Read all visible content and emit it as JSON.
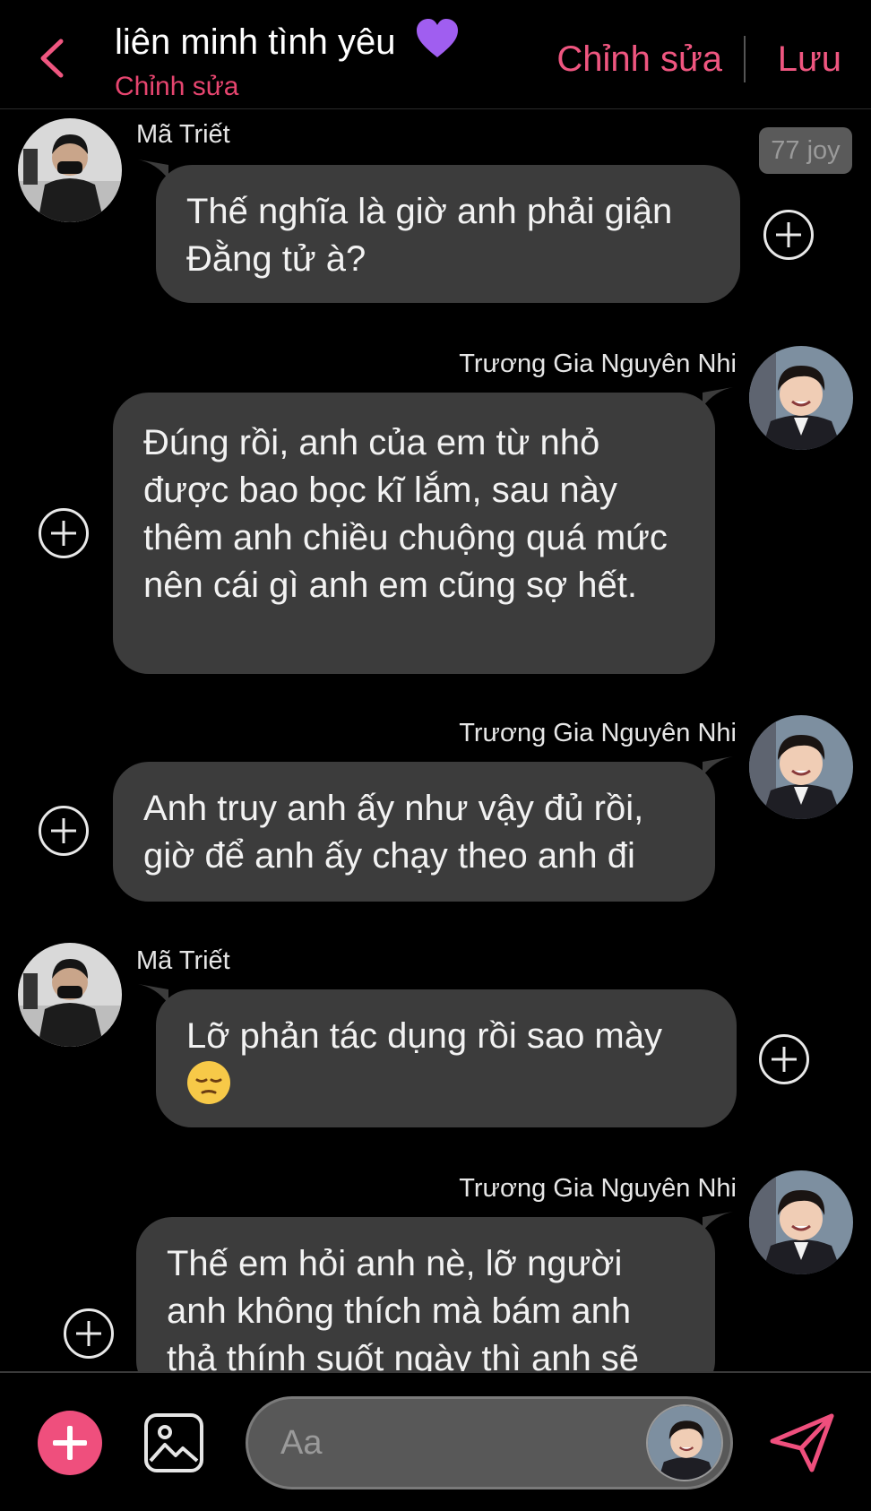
{
  "header": {
    "title": "liên minh tình yêu",
    "subtitle": "Chỉnh sửa",
    "edit_label": "Chỉnh sửa",
    "save_label": "Lưu",
    "accent_color": "#ef5680"
  },
  "messages": [
    {
      "sender": "Mã Triết",
      "text": "Thế nghĩa là giờ anh phải giận Đằng tử à?",
      "side": "left",
      "badge": "77 joy"
    },
    {
      "sender": "Trương Gia Nguyên Nhi",
      "text": "Đúng rồi, anh của em từ nhỏ được bao bọc kĩ lắm, sau này thêm anh chiều chuộng quá mức nên cái gì anh em cũng sợ hết.",
      "side": "right"
    },
    {
      "sender": "Trương Gia Nguyên Nhi",
      "text": "Anh truy anh ấy như vậy đủ rồi, giờ để anh ấy chạy theo anh đi",
      "side": "right"
    },
    {
      "sender": "Mã Triết",
      "text": "Lỡ phản tác dụng rồi sao mày",
      "emoji": "pensive-face",
      "side": "left"
    },
    {
      "sender": "Trương Gia Nguyên Nhi",
      "text": "Thế em hỏi anh nè, lỡ người anh không thích mà bám anh thả thính suốt ngày thì anh sẽ",
      "side": "right"
    }
  ],
  "composer": {
    "placeholder": "Aa",
    "icons": [
      "plus-icon",
      "image-icon",
      "send-icon"
    ]
  }
}
